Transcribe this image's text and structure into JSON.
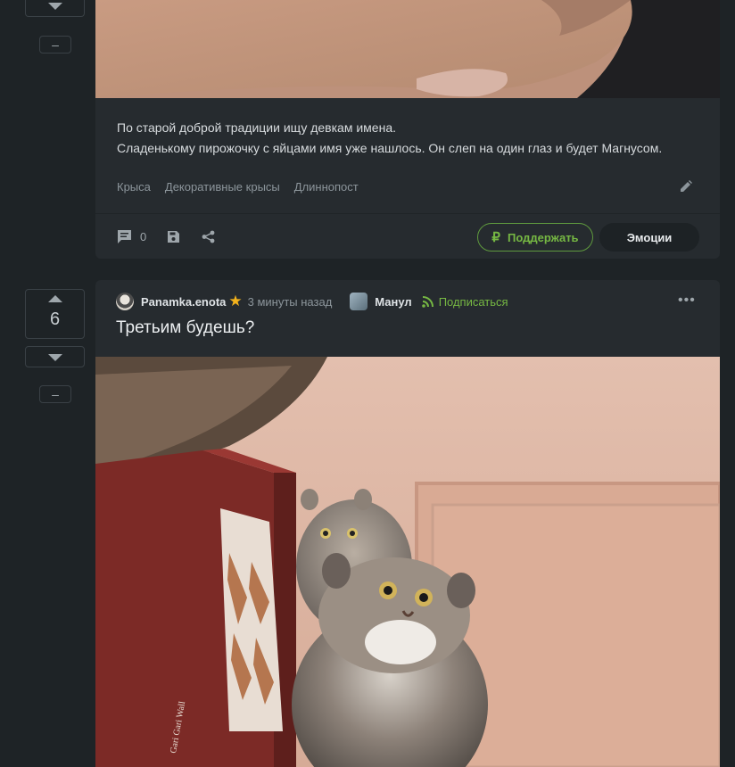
{
  "post1": {
    "text_lines": [
      "По старой доброй традиции ищу девкам имена.",
      "Сладенькому пирожочку с яйцами имя уже нашлось. Он слеп на один глаз и будет Магнусом."
    ],
    "tags": [
      "Крыса",
      "Декоративные крысы",
      "Длиннопост"
    ],
    "comments_count": "0",
    "support_label": "Поддержать",
    "emotions_label": "Эмоции",
    "minus_label": "–"
  },
  "post2": {
    "score": "6",
    "author": "Panamka.enota",
    "time": "3 минуты назад",
    "community": "Манул",
    "subscribe_label": "Подписаться",
    "title": "Третьим будешь?",
    "minus_label": "–",
    "more_label": "•••"
  },
  "colors": {
    "background": "#1e2326",
    "card": "#262b2f",
    "accent_green": "#76b843",
    "star": "#f2b21c"
  },
  "icons": [
    "chevron-down-icon",
    "chevron-up-icon",
    "comment-icon",
    "save-icon",
    "share-icon",
    "ruble-icon",
    "star-icon",
    "rss-icon",
    "pencil-icon",
    "more-icon"
  ]
}
